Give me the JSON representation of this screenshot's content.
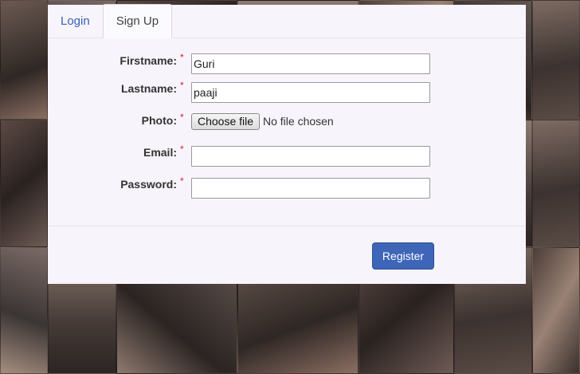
{
  "tabs": [
    {
      "label": "Login"
    },
    {
      "label": "Sign Up"
    }
  ],
  "form": {
    "required_marker": "*",
    "firstname": {
      "label": "Firstname:",
      "value": "Guri"
    },
    "lastname": {
      "label": "Lastname:",
      "value": "paaji"
    },
    "photo": {
      "label": "Photo:",
      "button": "Choose file",
      "status": "No file chosen"
    },
    "email": {
      "label": "Email:",
      "value": ""
    },
    "password": {
      "label": "Password:",
      "value": ""
    }
  },
  "footer": {
    "register_label": "Register"
  },
  "colors": {
    "accent": "#3e65b8",
    "required": "#d62020",
    "panel_bg": "#f7f4fb"
  }
}
